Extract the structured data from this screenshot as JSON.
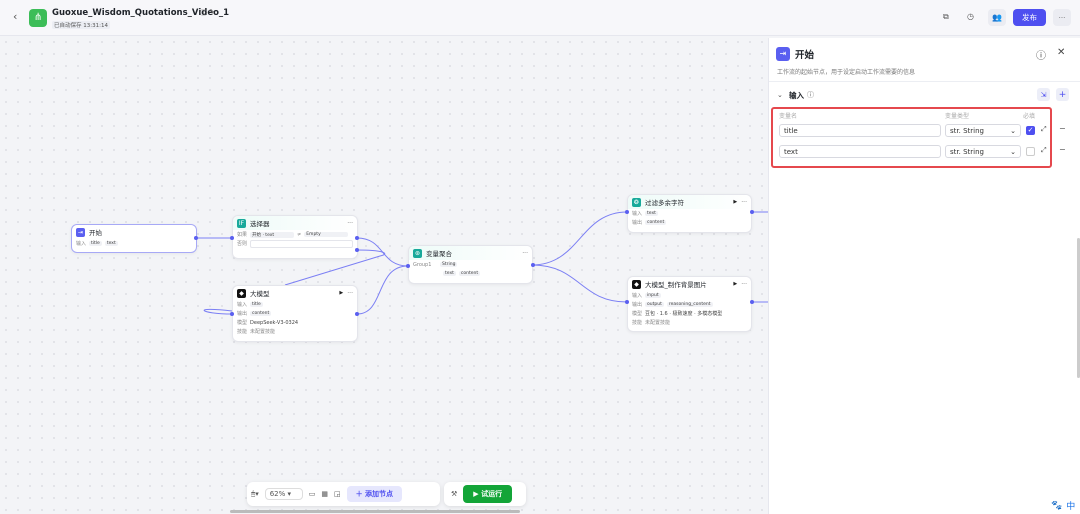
{
  "header": {
    "title": "Guoxue_Wisdom_Quotations_Video_1",
    "autosave": "已自动保存 13:31:14",
    "publish": "发布",
    "more": "···"
  },
  "nodes": {
    "start": {
      "title": "开始",
      "input_label": "输入",
      "inputs": [
        "title",
        "text"
      ]
    },
    "selector": {
      "title": "选择器",
      "if_label": "如果",
      "cond_left": "开始 · text",
      "cond_op": "≠",
      "cond_right": "Empty",
      "else_label": "否则"
    },
    "llm": {
      "title": "大模型",
      "input_label": "输入",
      "input": "title",
      "output_label": "输出",
      "output": "content",
      "model_label": "模型",
      "model": "DeepSeek-V3-0324",
      "skill_label": "技能",
      "skill": "未配置技能"
    },
    "aggregator": {
      "title": "变量聚合",
      "group_label": "Group1",
      "type": "String",
      "vars": [
        "text",
        "content"
      ]
    },
    "filter": {
      "title": "过滤多余字符",
      "input_label": "输入",
      "input": "text",
      "output_label": "输出",
      "output": "content"
    },
    "llm2": {
      "title": "大模型_制作背景图片",
      "input_label": "输入",
      "input": "input",
      "output_label": "输出",
      "outputs": [
        "output",
        "reasoning_content"
      ],
      "model_label": "模型",
      "model": "豆包 · 1.6 · 极致速度 · 多模态模型",
      "skill_label": "技能",
      "skill": "未配置技能"
    }
  },
  "toolbar": {
    "zoom": "62%",
    "add_node": "添加节点",
    "test_run": "试运行"
  },
  "panel": {
    "title": "开始",
    "description": "工作流的起始节点，用于设定启动工作流需要的信息",
    "section": "输入",
    "col_name": "变量名",
    "col_type": "变量类型",
    "col_required": "必填",
    "rows": [
      {
        "name": "title",
        "type": "str. String",
        "required": true
      },
      {
        "name": "text",
        "type": "str. String",
        "required": false
      }
    ]
  },
  "ime": {
    "lang": "中"
  },
  "colors": {
    "accent": "#4e4ff0",
    "run": "#13a538",
    "highlight": "#e5484d"
  }
}
